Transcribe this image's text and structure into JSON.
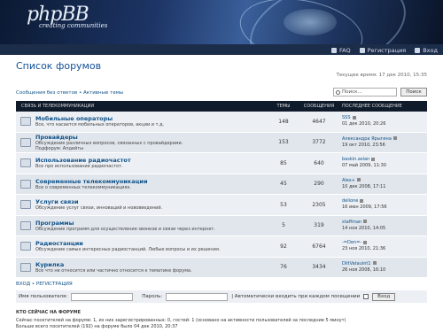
{
  "header": {
    "logo_main": "phpBB",
    "logo_tagline": "creating communities",
    "nav": {
      "faq": "FAQ",
      "register": "Регистрация",
      "login": "Вход"
    }
  },
  "page": {
    "title": "Список форумов",
    "current_time": "Текущее время: 17 дек 2010, 15:35",
    "quick_links": "Сообщения без ответов • Активные темы",
    "search_placeholder": "Поиск...",
    "search_button": "Поиск"
  },
  "table": {
    "headers": {
      "forum": "СВЯЗЬ И ТЕЛЕКОММУНИКАЦИИ",
      "topics": "ТЕМЫ",
      "posts": "СООБЩЕНИЯ",
      "last_post": "ПОСЛЕДНЕЕ СООБЩЕНИЕ"
    },
    "rows": [
      {
        "name": "Мобильные операторы",
        "desc": "Все, что касается мобильных операторов, акции и т.д.",
        "topics": "148",
        "posts": "4647",
        "author": "SSS",
        "date": "01 дек 2010, 20:26"
      },
      {
        "name": "Провайдеры",
        "desc": "Обсуждение различных вопросов, связанных с провайдерами.",
        "desc2": "Подфорум: Апдейты",
        "topics": "153",
        "posts": "3772",
        "author": "Александра Ярыгина",
        "date": "19 окт 2010, 23:56"
      },
      {
        "name": "Использование радиочастот",
        "desc": "Все про использование радиочастот.",
        "topics": "85",
        "posts": "640",
        "author": "baskin.aslan",
        "date": "07 май 2009, 11:30"
      },
      {
        "name": "Современные телекоммуникации",
        "desc": "Все о современных телекоммуникациях.",
        "topics": "45",
        "posts": "290",
        "author": "Alex+",
        "date": "10 дек 2008, 17:11"
      },
      {
        "name": "Услуги связи",
        "desc": "Обсуждение услуг связи, инноваций и нововведений.",
        "topics": "53",
        "posts": "2305",
        "author": "delione",
        "date": "16 июн 2009, 17:56"
      },
      {
        "name": "Программы",
        "desc": "Обсуждение программ для осуществления звонков и связи через интернет.",
        "topics": "5",
        "posts": "319",
        "author": "staffman",
        "date": "14 ноя 2010, 14:05"
      },
      {
        "name": "Радиостанции",
        "desc": "Обсуждение самых интересных радиостанций. Любые вопросы и их решения.",
        "topics": "92",
        "posts": "6764",
        "author": "-=Den=-",
        "date": "23 ноя 2010, 21:36"
      },
      {
        "name": "Курилка",
        "desc": "Все что не относится или частично относится к тематике форума.",
        "topics": "76",
        "posts": "3434",
        "author": "DiltVatauint1",
        "date": "26 ноя 2008, 16:10"
      }
    ]
  },
  "login": {
    "heading": "ВХОД • РЕГИСТРАЦИЯ",
    "username_label": "Имя пользователя:",
    "password_label": "Пароль:",
    "autologin_label": "| Автоматически входить при каждом посещении",
    "submit": "Вход"
  },
  "who": {
    "heading": "КТО СЕЙЧАС НА ФОРУМЕ",
    "line1": "Сейчас посетителей на форуме: 1, из них зарегистрированных: 0, гостей: 1 (основано на активности пользователей за последние 5 минут)",
    "line2": "Больше всего посетителей (192) на форуме было 04 дек 2010, 20:37"
  }
}
